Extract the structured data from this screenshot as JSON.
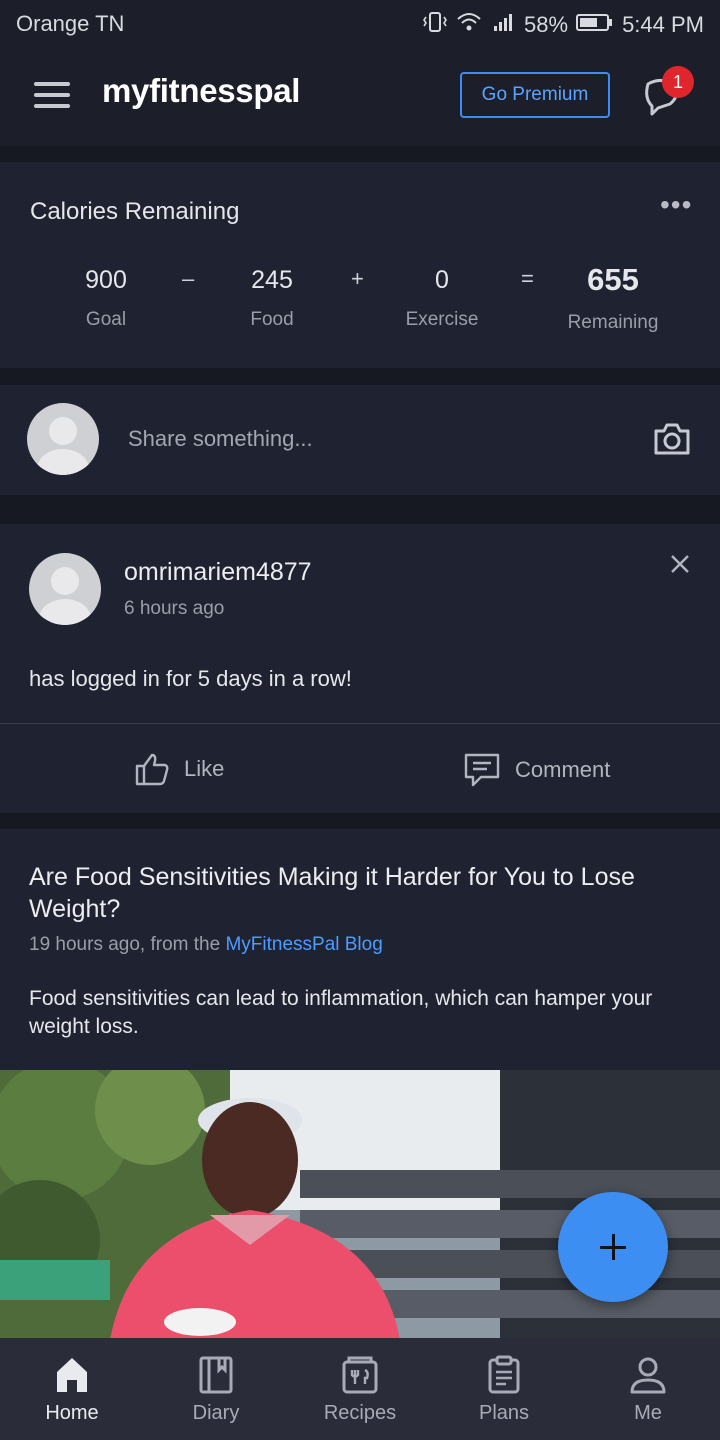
{
  "status_bar": {
    "carrier": "Orange TN",
    "battery": "58%",
    "time": "5:44 PM"
  },
  "app_bar": {
    "brand": "myfitnesspal",
    "premium_label": "Go Premium",
    "notification_count": "1"
  },
  "calories": {
    "title": "Calories Remaining",
    "goal": {
      "value": "900",
      "label": "Goal"
    },
    "food": {
      "value": "245",
      "label": "Food"
    },
    "exercise": {
      "value": "0",
      "label": "Exercise"
    },
    "remaining": {
      "value": "655",
      "label": "Remaining"
    },
    "ops": {
      "minus": "–",
      "plus": "+",
      "equals": "="
    }
  },
  "share": {
    "placeholder": "Share something..."
  },
  "post": {
    "username": "omrimariem4877",
    "time": "6 hours ago",
    "text": "has logged in for 5 days in a row!",
    "like_label": "Like",
    "comment_label": "Comment"
  },
  "article": {
    "headline": "Are Food Sensitivities Making it Harder for You to Lose Weight?",
    "meta_prefix": "19 hours ago, from the ",
    "source": "MyFitnessPal Blog",
    "summary": "Food sensitivities can lead to inflammation, which can hamper your weight loss."
  },
  "nav": {
    "items": [
      {
        "label": "Home",
        "icon": "home-icon"
      },
      {
        "label": "Diary",
        "icon": "book-icon"
      },
      {
        "label": "Recipes",
        "icon": "recipes-icon"
      },
      {
        "label": "Plans",
        "icon": "clipboard-icon"
      },
      {
        "label": "Me",
        "icon": "person-icon"
      }
    ]
  },
  "colors": {
    "accent": "#3d8ef2",
    "link": "#4d9cff",
    "badge": "#e0262d",
    "background": "#161922",
    "card": "#1f2230"
  }
}
